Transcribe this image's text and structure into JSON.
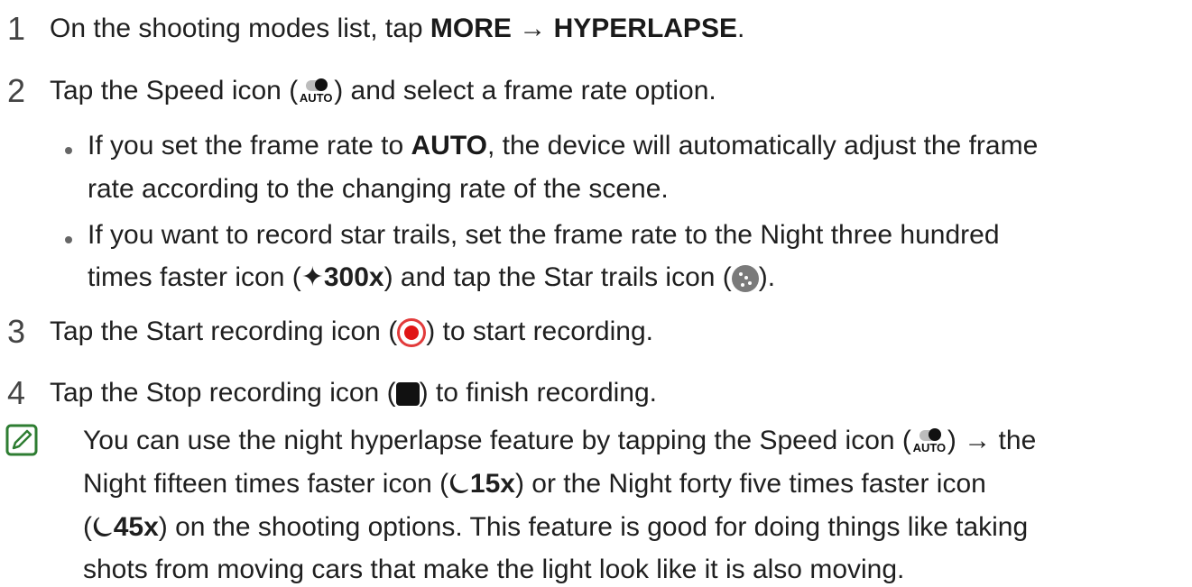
{
  "steps": [
    {
      "num": "1",
      "text": {
        "pre": "On the shooting modes list, tap ",
        "b1": "MORE",
        "mid": " → ",
        "b2": "HYPERLAPSE",
        "post": "."
      }
    },
    {
      "num": "2",
      "text": {
        "pre": "Tap the Speed icon (",
        "post": ") and select a frame rate option."
      }
    },
    {
      "num": "3",
      "text": {
        "pre": "Tap the Start recording icon (",
        "post": ") to start recording."
      }
    },
    {
      "num": "4",
      "text": {
        "pre": "Tap the Stop recording icon (",
        "post": ") to finish recording."
      }
    }
  ],
  "bullets": [
    {
      "line1": {
        "pre": "If you set the frame rate to ",
        "b": "AUTO",
        "post": ", the device will automatically adjust the frame"
      },
      "line2": "rate according to the changing rate of the scene."
    },
    {
      "line1": "If you want to record star trails, set the frame rate to the Night three hundred",
      "line2": {
        "pre": "times faster icon (",
        "mid": ") and tap the Star trails icon (",
        "post": ")."
      }
    }
  ],
  "icons": {
    "speed_auto_text": "AUTO",
    "night300": "✦300x",
    "night15": "⏾15x",
    "night45": "⏾45x"
  },
  "note": {
    "l1": {
      "pre": "You can use the night hyperlapse feature by tapping the Speed icon (",
      "post": ") → the"
    },
    "l2": {
      "pre": "Night fifteen times faster icon (",
      "post": ") or the Night forty five times faster icon"
    },
    "l3": {
      "pre": "(",
      "post": ") on the shooting options. This feature is good for doing things like taking"
    },
    "l4": "shots from moving cars that make the light look like it is also moving."
  },
  "colors": {
    "record_red": "#e01515",
    "note_green": "#2e7d32"
  }
}
